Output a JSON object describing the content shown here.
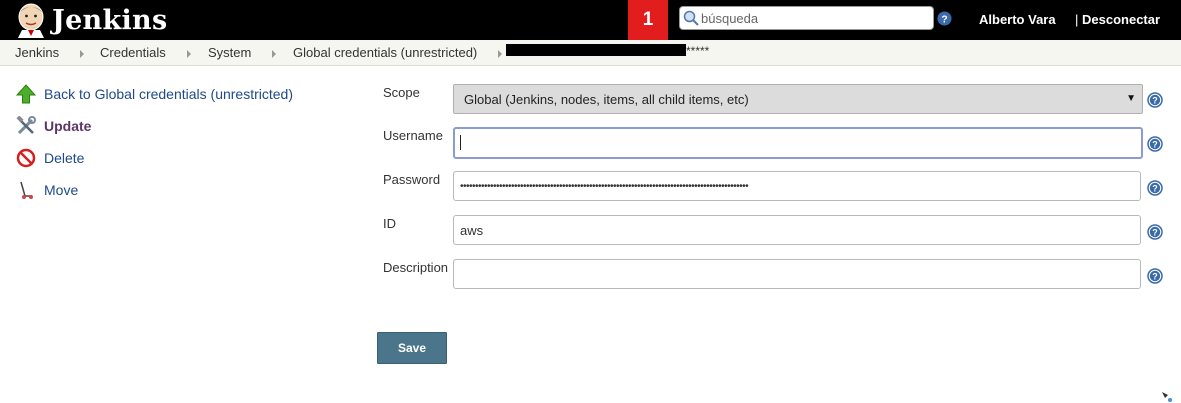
{
  "header": {
    "logo_text": "Jenkins",
    "notification_count": "1",
    "search_placeholder": "búsqueda",
    "user_name": "Alberto Vara",
    "logout_sep": "|",
    "logout_label": "Desconectar"
  },
  "breadcrumb": {
    "items": [
      "Jenkins",
      "Credentials",
      "System",
      "Global credentials (unrestricted)"
    ],
    "masked_suffix": "*****"
  },
  "sidebar": {
    "items": [
      {
        "label": "Back to Global credentials (unrestricted)",
        "icon": "up-arrow-icon"
      },
      {
        "label": "Update",
        "icon": "tools-icon"
      },
      {
        "label": "Delete",
        "icon": "no-entry-icon"
      },
      {
        "label": "Move",
        "icon": "move-icon"
      }
    ]
  },
  "form": {
    "scope_label": "Scope",
    "scope_value": "Global (Jenkins, nodes, items, all child items, etc)",
    "username_label": "Username",
    "username_value": "",
    "password_label": "Password",
    "password_value": "••••••••••••••••••••••••••••••••••••••••••••••••••••••••••••••••••••••••••••••••••••••••••••••••",
    "id_label": "ID",
    "id_value": "aws",
    "description_label": "Description",
    "description_value": "",
    "save_label": "Save"
  },
  "colors": {
    "header_bg": "#000000",
    "notification_bg": "#e11d1d",
    "save_button_bg": "#4b758b",
    "link_color": "#204a87"
  }
}
